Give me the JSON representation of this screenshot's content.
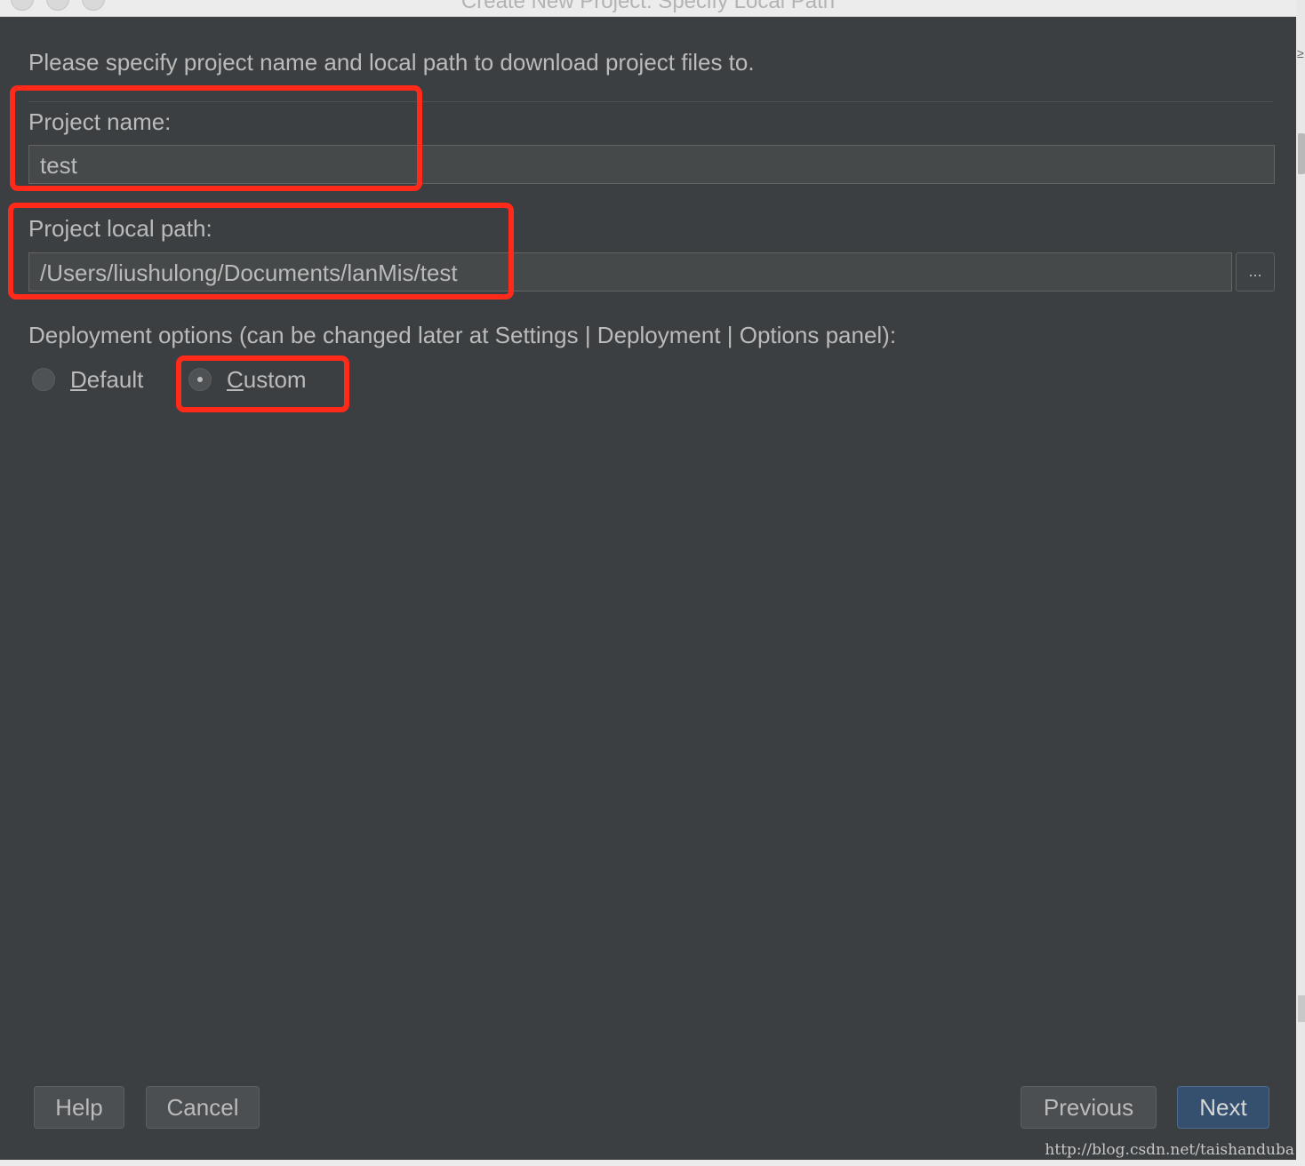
{
  "window": {
    "title": "Create New Project: Specify Local Path"
  },
  "intro_text": "Please specify project name and local path to download project files to.",
  "project_name": {
    "label": "Project name:",
    "value": "test"
  },
  "project_path": {
    "label": "Project local path:",
    "value": "/Users/liushulong/Documents/lanMis/test",
    "browse_label": "..."
  },
  "deployment": {
    "label": "Deployment options (can be changed later at Settings | Deployment | Options panel):",
    "options": [
      {
        "mnemonic": "D",
        "rest": "efault",
        "selected": false
      },
      {
        "mnemonic": "C",
        "rest": "ustom",
        "selected": true
      }
    ]
  },
  "buttons": {
    "help": "Help",
    "cancel": "Cancel",
    "previous": "Previous",
    "next": "Next"
  },
  "watermark": "http://blog.csdn.net/taishanduba",
  "colors": {
    "dialog_bg": "#3c3f41",
    "text": "#bbbbbb",
    "field_bg": "#45494a",
    "highlight_annotation": "#ff2a1a",
    "primary_button": "#35506f"
  }
}
